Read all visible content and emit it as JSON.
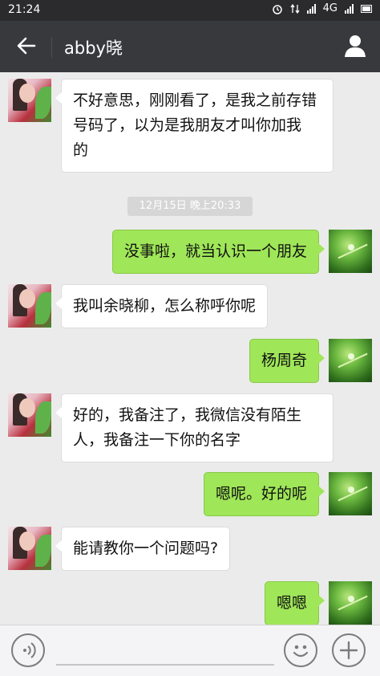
{
  "status_bar": {
    "time": "21:24",
    "network": "4G"
  },
  "header": {
    "title": "abby晓",
    "back_icon": "arrow-left-icon",
    "profile_icon": "person-icon"
  },
  "chat": {
    "timestamp": "12月15日 晚上20:33",
    "messages": [
      {
        "sender": "contact",
        "lines": [
          "不好意思，刚刚看了，是我之前存错",
          "号码了，以为是我朋友才叫你加我",
          "的"
        ]
      },
      {
        "sender": "me",
        "lines": [
          "没事啦，就当认识一个朋友"
        ]
      },
      {
        "sender": "contact",
        "lines": [
          "我叫余晓柳，怎么称呼你呢"
        ]
      },
      {
        "sender": "me",
        "lines": [
          "杨周奇"
        ]
      },
      {
        "sender": "contact",
        "lines": [
          "好的，我备注了，我微信没有陌生",
          "人，我备注一下你的名字"
        ]
      },
      {
        "sender": "me",
        "lines": [
          "嗯呢。好的呢"
        ]
      },
      {
        "sender": "contact",
        "lines": [
          "能请教你一个问题吗?"
        ]
      },
      {
        "sender": "me",
        "lines": [
          "嗯嗯"
        ]
      }
    ]
  },
  "input_bar": {
    "voice_icon": "voice-icon",
    "emoji_icon": "emoji-icon",
    "plus_icon": "plus-icon",
    "placeholder": ""
  },
  "colors": {
    "bubble_me": "#9fe658",
    "bubble_contact": "#ffffff",
    "header_bg": "#38393d",
    "chat_bg": "#ebebeb"
  }
}
